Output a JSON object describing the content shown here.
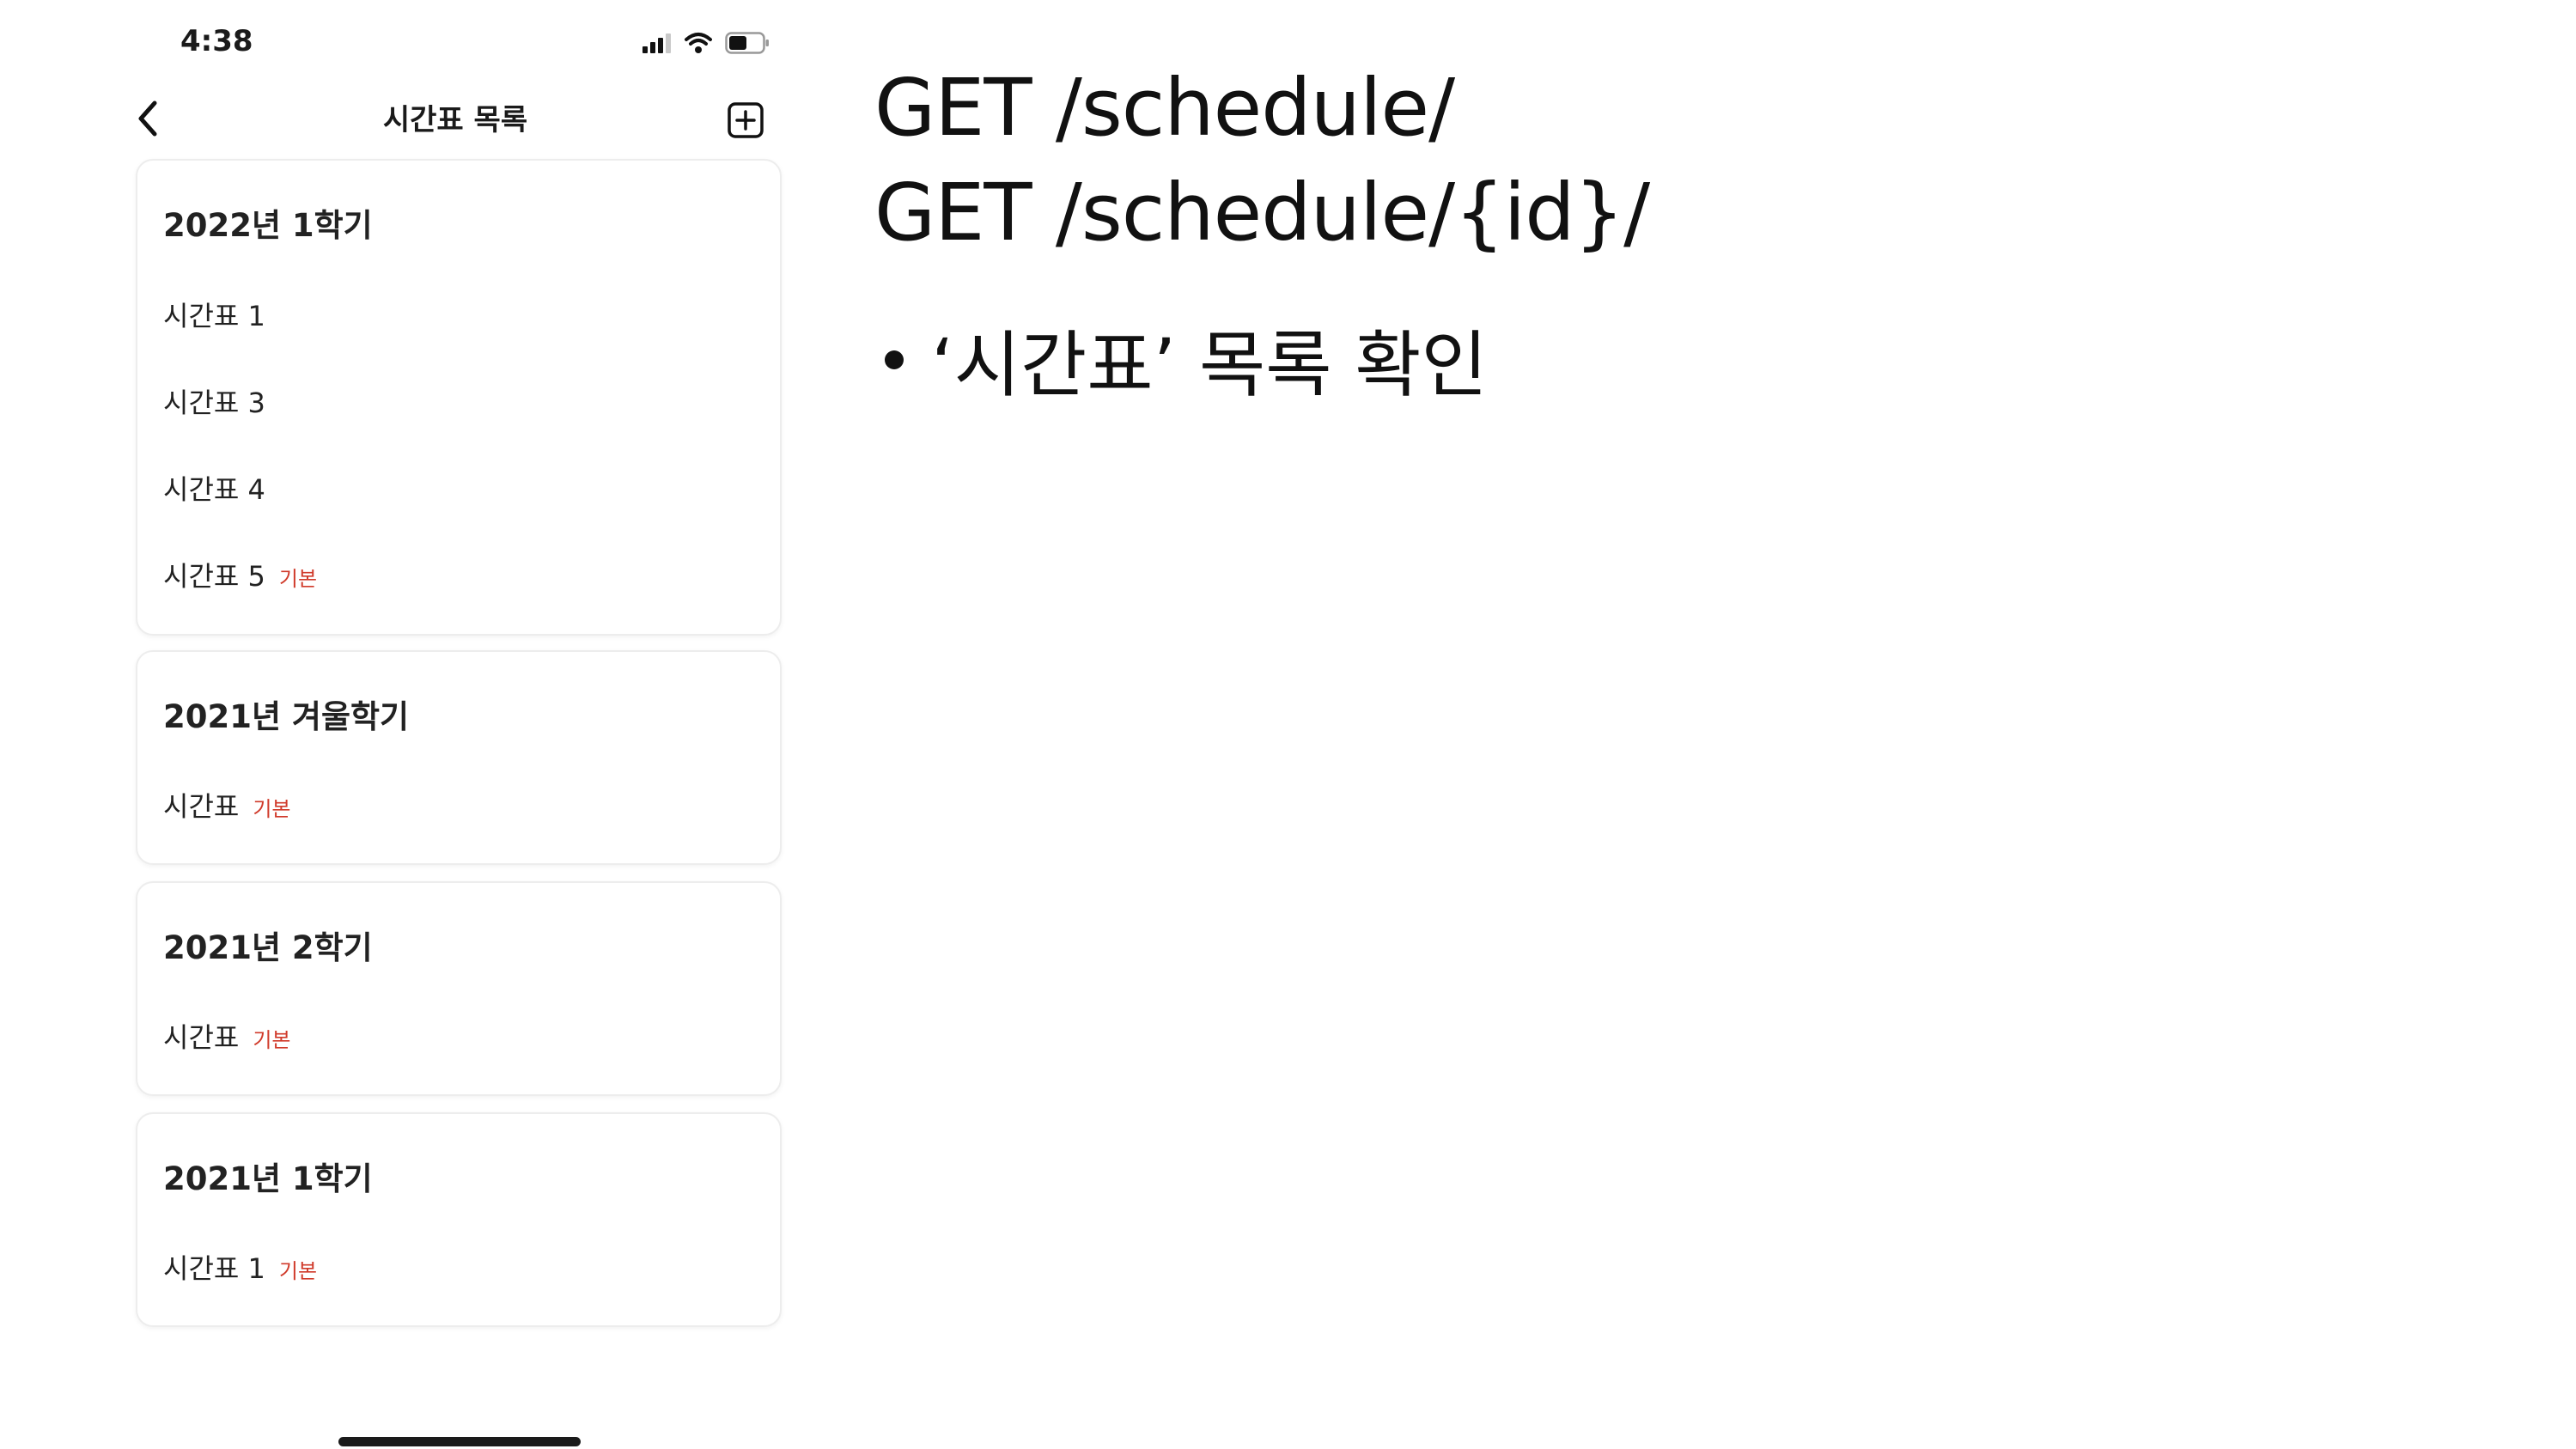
{
  "status_bar": {
    "time": "4:38",
    "icons": [
      "signal-icon",
      "wifi-icon",
      "battery-icon"
    ]
  },
  "nav": {
    "title": "시간표 목록",
    "back_icon": "chevron-left-icon",
    "add_icon": "plus-square-icon"
  },
  "groups": [
    {
      "title": "2022년 1학기",
      "items": [
        {
          "name": "시간표 1",
          "badge": ""
        },
        {
          "name": "시간표 3",
          "badge": ""
        },
        {
          "name": "시간표 4",
          "badge": ""
        },
        {
          "name": "시간표 5",
          "badge": "기본"
        }
      ]
    },
    {
      "title": "2021년 겨울학기",
      "items": [
        {
          "name": "시간표",
          "badge": "기본"
        }
      ]
    },
    {
      "title": "2021년 2학기",
      "items": [
        {
          "name": "시간표",
          "badge": "기본"
        }
      ]
    },
    {
      "title": "2021년 1학기",
      "items": [
        {
          "name": "시간표 1",
          "badge": "기본"
        }
      ]
    }
  ],
  "slide": {
    "api_lines": [
      "GET /schedule/",
      "GET /schedule/{id}/"
    ],
    "bullets": [
      "‘시간표’ 목록 확인"
    ]
  },
  "colors": {
    "badge": "#d03a2a",
    "card_border": "#ededed",
    "text": "#1a1a1a"
  }
}
